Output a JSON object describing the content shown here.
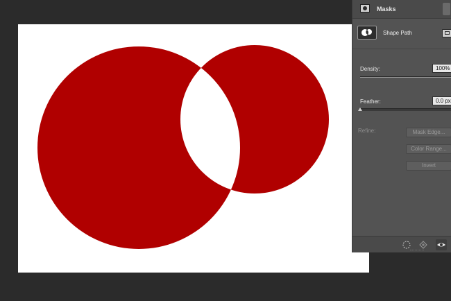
{
  "panel": {
    "title": "Masks",
    "mask_type": "Shape Path",
    "density": {
      "label": "Density:",
      "value": "100%",
      "level": 1.0
    },
    "feather": {
      "label": "Feather:",
      "value": "0.0 px",
      "level": 0.0
    },
    "refine": {
      "label": "Refine:",
      "buttons": [
        "Mask Edge...",
        "Color Range...",
        "Invert"
      ]
    },
    "bottom_icons": [
      "load-selection-icon",
      "apply-mask-icon",
      "visibility-eye-icon"
    ]
  },
  "canvas": {
    "background": "#ffffff",
    "shape_color": "#b00000"
  },
  "colors": {
    "workspace": "#2b2b2b",
    "panel": "#535353"
  }
}
